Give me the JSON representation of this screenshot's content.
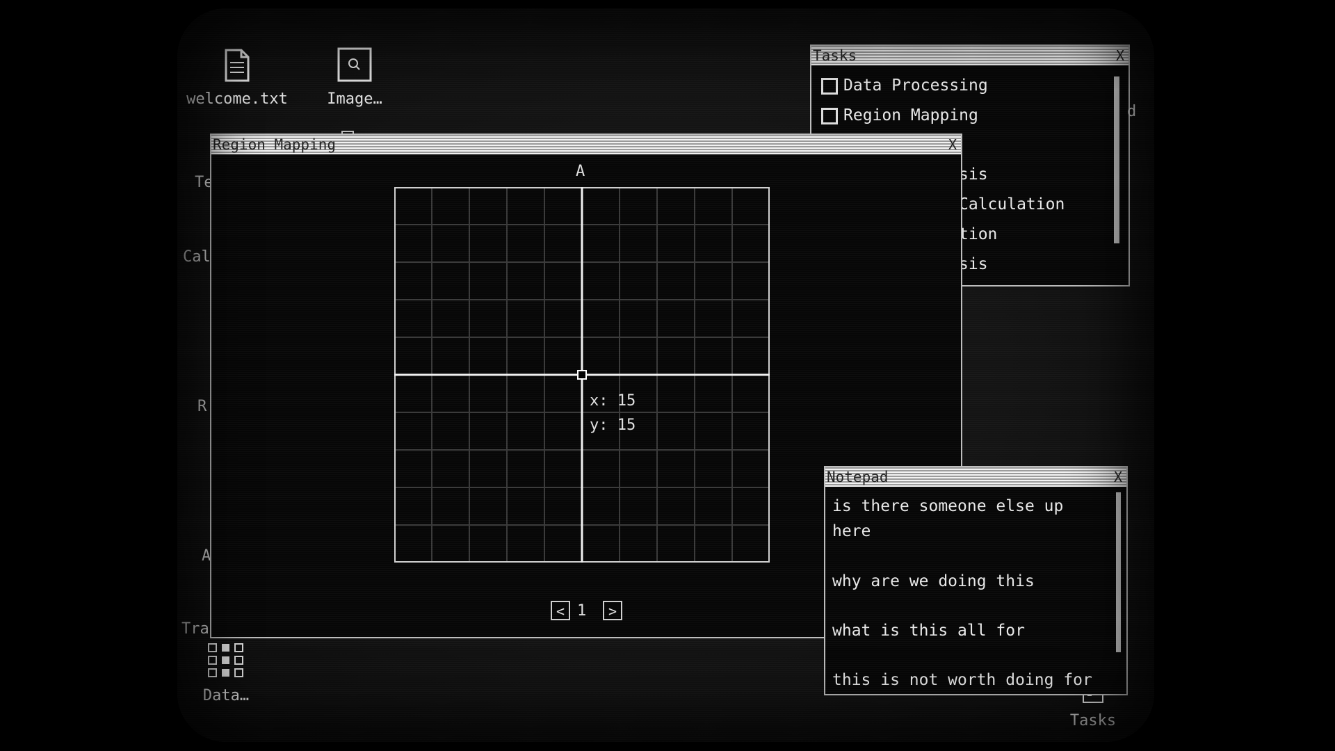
{
  "desktop": {
    "icons": [
      {
        "label": "welcome.txt",
        "glyph": "document-icon"
      },
      {
        "label": "Image…",
        "glyph": "image-search-icon"
      },
      {
        "label": "Data…",
        "glyph": "checklist-icon"
      },
      {
        "label": "Tasks",
        "glyph": "tasks-icon"
      }
    ],
    "partial_labels": [
      "Te",
      "Cal",
      "R",
      "A",
      "Tra"
    ]
  },
  "tasks_window": {
    "title": "Tasks",
    "close_label": "X",
    "items": [
      {
        "label": "Data Processing",
        "checked": false
      },
      {
        "label": "Region Mapping",
        "checked": false
      }
    ],
    "partial_items": [
      "sis",
      "Calculation",
      "tion",
      "sis"
    ],
    "partial_right": "d"
  },
  "region_mapping_window": {
    "title": "Region Mapping",
    "close_label": "X",
    "grid_label": "A",
    "cursor": {
      "x": 15,
      "y": 15
    },
    "x_text": "x: 15",
    "y_text": "y: 15",
    "page": "1",
    "prev_label": "<",
    "next_label": ">"
  },
  "notepad_window": {
    "title": "Notepad",
    "close_label": "X",
    "lines": [
      "is there someone else up",
      "here",
      "why are we doing this",
      "what is this all for",
      "this is not worth doing for"
    ]
  },
  "colors": {
    "background": "#000000",
    "text": "#e8e8e8",
    "titlebar": "#d8d8d8"
  }
}
